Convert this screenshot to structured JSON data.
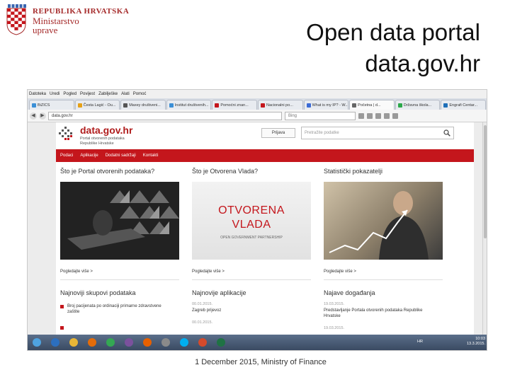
{
  "slide": {
    "title_line1": "Open data portal",
    "title_line2": "data.gov.hr",
    "footer": "1 December 2015, Ministry of Finance"
  },
  "logo": {
    "line1": "REPUBLIKA HRVATSKA",
    "line2": "Ministarstvo",
    "line3": "uprave"
  },
  "browser": {
    "menu": [
      "Datoteka",
      "Uredi",
      "Pogled",
      "Povijest",
      "Zabilješke",
      "Alati",
      "Pomoć"
    ],
    "tabs": [
      {
        "label": "BiZICS",
        "color": "#3b8fd6"
      },
      {
        "label": "Česta Lagić - Ou...",
        "color": "#e6a117"
      },
      {
        "label": "Maxey društveni...",
        "color": "#555555"
      },
      {
        "label": "Institut društvenih...",
        "color": "#3b8fd6"
      },
      {
        "label": "Pomoćni znan...",
        "color": "#c4161c"
      },
      {
        "label": "Nacionalni po...",
        "color": "#c4161c"
      },
      {
        "label": "What is my IP? - W...",
        "color": "#3b6bd6"
      },
      {
        "label": "Početna | d...",
        "color": "#666666"
      },
      {
        "label": "Državna škola...",
        "color": "#2ba84a"
      },
      {
        "label": "Engrafi Centar...",
        "color": "#1e6fb8"
      }
    ],
    "url": "data.gov.hr",
    "search_placeholder": "Bing"
  },
  "site": {
    "name": "data.gov.hr",
    "subtitle_line1": "Portal otvorenih podataka",
    "subtitle_line2": "Republike Hrvatske",
    "login_label": "Prijava",
    "search_placeholder": "Pretražite podatke",
    "nav": [
      "Podaci",
      "Aplikacije",
      "Dodatni sadržaji",
      "Kontakti"
    ],
    "columns": [
      {
        "heading": "Što je Portal otvorenih podataka?",
        "link": "Pogledajte više >"
      },
      {
        "heading": "Što je Otvorena Vlada?",
        "link": "Pogledajte više >"
      },
      {
        "heading": "Statistički pokazatelji",
        "link": "Pogledajte više >"
      }
    ],
    "open_gov": {
      "line1": "OTVORENA",
      "line2": "VLADA",
      "line3": "OPEN GOVERNMENT PARTNERSHIP"
    },
    "sections": [
      {
        "heading": "Najnoviji skupovi podataka"
      },
      {
        "heading": "Najnovije aplikacije"
      },
      {
        "heading": "Najave događanja"
      }
    ],
    "datasets": [
      {
        "title": "Broj pacijenata po ordinaciji primarne zdravstvene zaštite"
      }
    ],
    "apps": [
      {
        "date": "00.01.2015.",
        "title": "Zagreb prijevoz"
      },
      {
        "date": "00.01.2015.",
        "title": ""
      }
    ],
    "events": [
      {
        "date": "19.03.2015.",
        "title": "Predstavljanje Portala otvorenih podataka Republike Hrvatske"
      },
      {
        "date": "19.03.2015.",
        "title": ""
      }
    ]
  },
  "taskbar": {
    "apps": [
      {
        "name": "windows-start",
        "color": "#4fa3e0"
      },
      {
        "name": "explorer",
        "color": "#2c6fbf"
      },
      {
        "name": "folder",
        "color": "#e8b637"
      },
      {
        "name": "media-player",
        "color": "#e46c0a"
      },
      {
        "name": "chrome",
        "color": "#34a853"
      },
      {
        "name": "viber",
        "color": "#7b519d"
      },
      {
        "name": "firefox",
        "color": "#e66000"
      },
      {
        "name": "notes",
        "color": "#8a8a8a"
      },
      {
        "name": "skype",
        "color": "#00aff0"
      },
      {
        "name": "paint",
        "color": "#d44a2b"
      },
      {
        "name": "excel",
        "color": "#1f7244"
      }
    ],
    "lang": "HR",
    "time": "10:03",
    "date": "13.3.2015."
  }
}
